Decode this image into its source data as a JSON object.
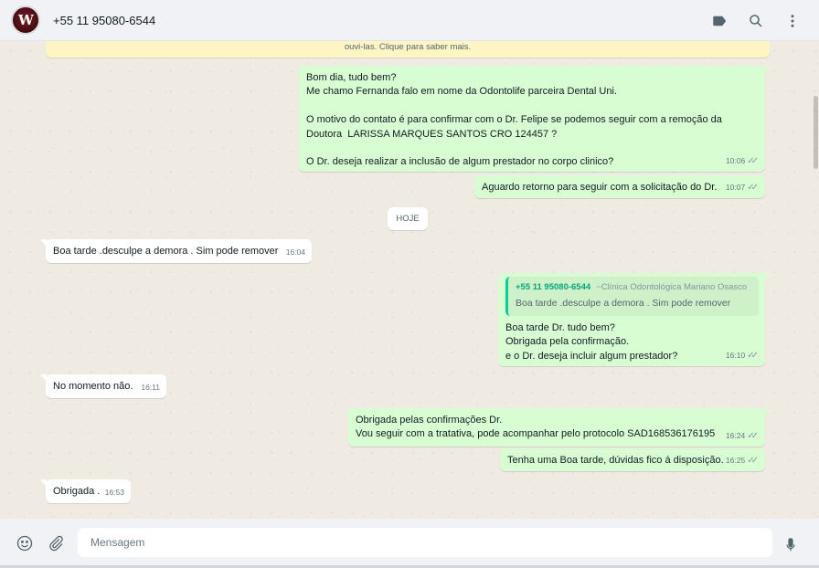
{
  "header": {
    "contact_name": "+55 11 95080-6544",
    "icons": [
      "label-icon",
      "search-icon",
      "menu-icon"
    ]
  },
  "notice": {
    "text": "ouvi-las. Clique para saber mais."
  },
  "day_separator": "HOJE",
  "messages": [
    {
      "direction": "out",
      "text": "Bom dia, tudo bem?\nMe chamo Fernanda falo em nome da Odontolife parceira Dental Uni.\n\nO motivo do contato é para confirmar com o Dr. Felipe se podemos seguir com a remoção da\nDoutora  LARISSA MARQUES SANTOS CRO 124457 ?\n\nO Dr. deseja realizar a inclusão de algum prestador no corpo clinico?",
      "time": "10:06"
    },
    {
      "direction": "out",
      "text": "Aguardo retorno para seguir com a solicitação do Dr.",
      "time": "10:07"
    },
    {
      "direction": "in",
      "text": "Boa tarde .desculpe a demora . Sim pode remover",
      "time": "16:04"
    },
    {
      "direction": "out",
      "quote": {
        "author": "+55 11 95080-6544",
        "subtitle": "~Clínica Odontológica Mariano Osasco",
        "text": "Boa tarde .desculpe a demora . Sim pode remover"
      },
      "text": "Boa tarde Dr. tudo bem?\nObrigada pela confirmação.\ne o Dr. deseja incluir algum prestador?",
      "time": "16:10"
    },
    {
      "direction": "in",
      "text": "No momento não.",
      "time": "16:11"
    },
    {
      "direction": "out",
      "text": "Obrigada pelas confirmações Dr.\nVou seguir com a tratativa, pode acompanhar pelo protocolo SAD168536176195",
      "time": "16:24"
    },
    {
      "direction": "out",
      "text": "Tenha uma Boa tarde, dúvidas fico á disposição.",
      "time": "16:25"
    },
    {
      "direction": "in",
      "text": "Obrigada .",
      "time": "16:53"
    }
  ],
  "composer": {
    "placeholder": "Mensagem",
    "icons": [
      "emoji-icon",
      "attach-icon",
      "mic-icon"
    ]
  },
  "colors": {
    "outgoing_bubble": "#d9fdd3",
    "incoming_bubble": "#ffffff",
    "chat_background": "#efeae2",
    "quote_accent": "#06cf9c",
    "header_background": "#f0f2f5"
  }
}
